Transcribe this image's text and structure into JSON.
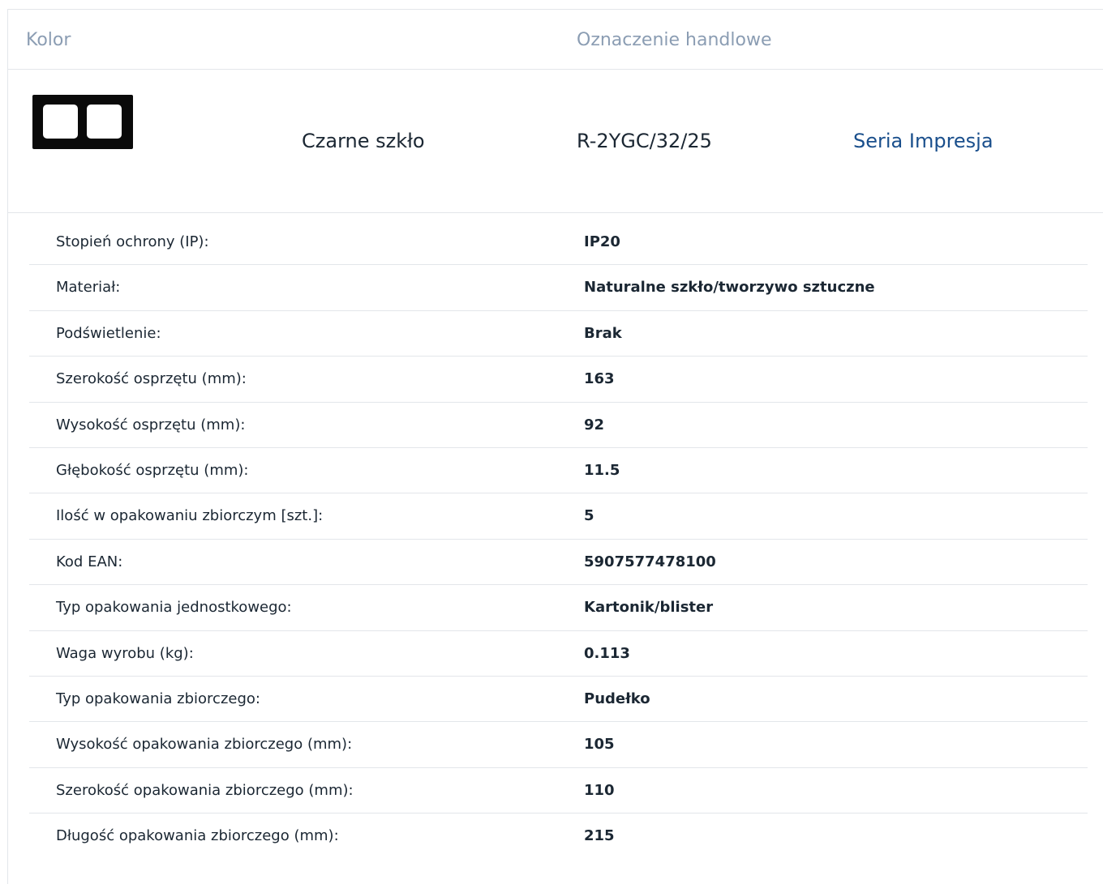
{
  "header": {
    "color_label": "Kolor",
    "trade_name_label": "Oznaczenie handlowe"
  },
  "product": {
    "thumbnail_icon": "double-frame-thumbnail",
    "color": "Czarne szkło",
    "code": "R-2YGC/32/25",
    "series_link": "Seria Impresja"
  },
  "specs": [
    {
      "label": "Stopień ochrony (IP):",
      "value": "IP20"
    },
    {
      "label": "Materiał:",
      "value": "Naturalne szkło/tworzywo sztuczne"
    },
    {
      "label": "Podświetlenie:",
      "value": "Brak"
    },
    {
      "label": "Szerokość osprzętu (mm):",
      "value": "163"
    },
    {
      "label": "Wysokość osprzętu (mm):",
      "value": "92"
    },
    {
      "label": "Głębokość osprzętu (mm):",
      "value": "11.5"
    },
    {
      "label": "Ilość w opakowaniu zbiorczym [szt.]:",
      "value": "5"
    },
    {
      "label": "Kod EAN:",
      "value": "5907577478100"
    },
    {
      "label": "Typ opakowania jednostkowego:",
      "value": "Kartonik/blister"
    },
    {
      "label": "Waga wyrobu (kg):",
      "value": "0.113"
    },
    {
      "label": "Typ opakowania zbiorczego:",
      "value": "Pudełko"
    },
    {
      "label": "Wysokość opakowania zbiorczego (mm):",
      "value": "105"
    },
    {
      "label": "Szerokość opakowania zbiorczego (mm):",
      "value": "110"
    },
    {
      "label": "Długość opakowania zbiorczego (mm):",
      "value": "215"
    }
  ]
}
